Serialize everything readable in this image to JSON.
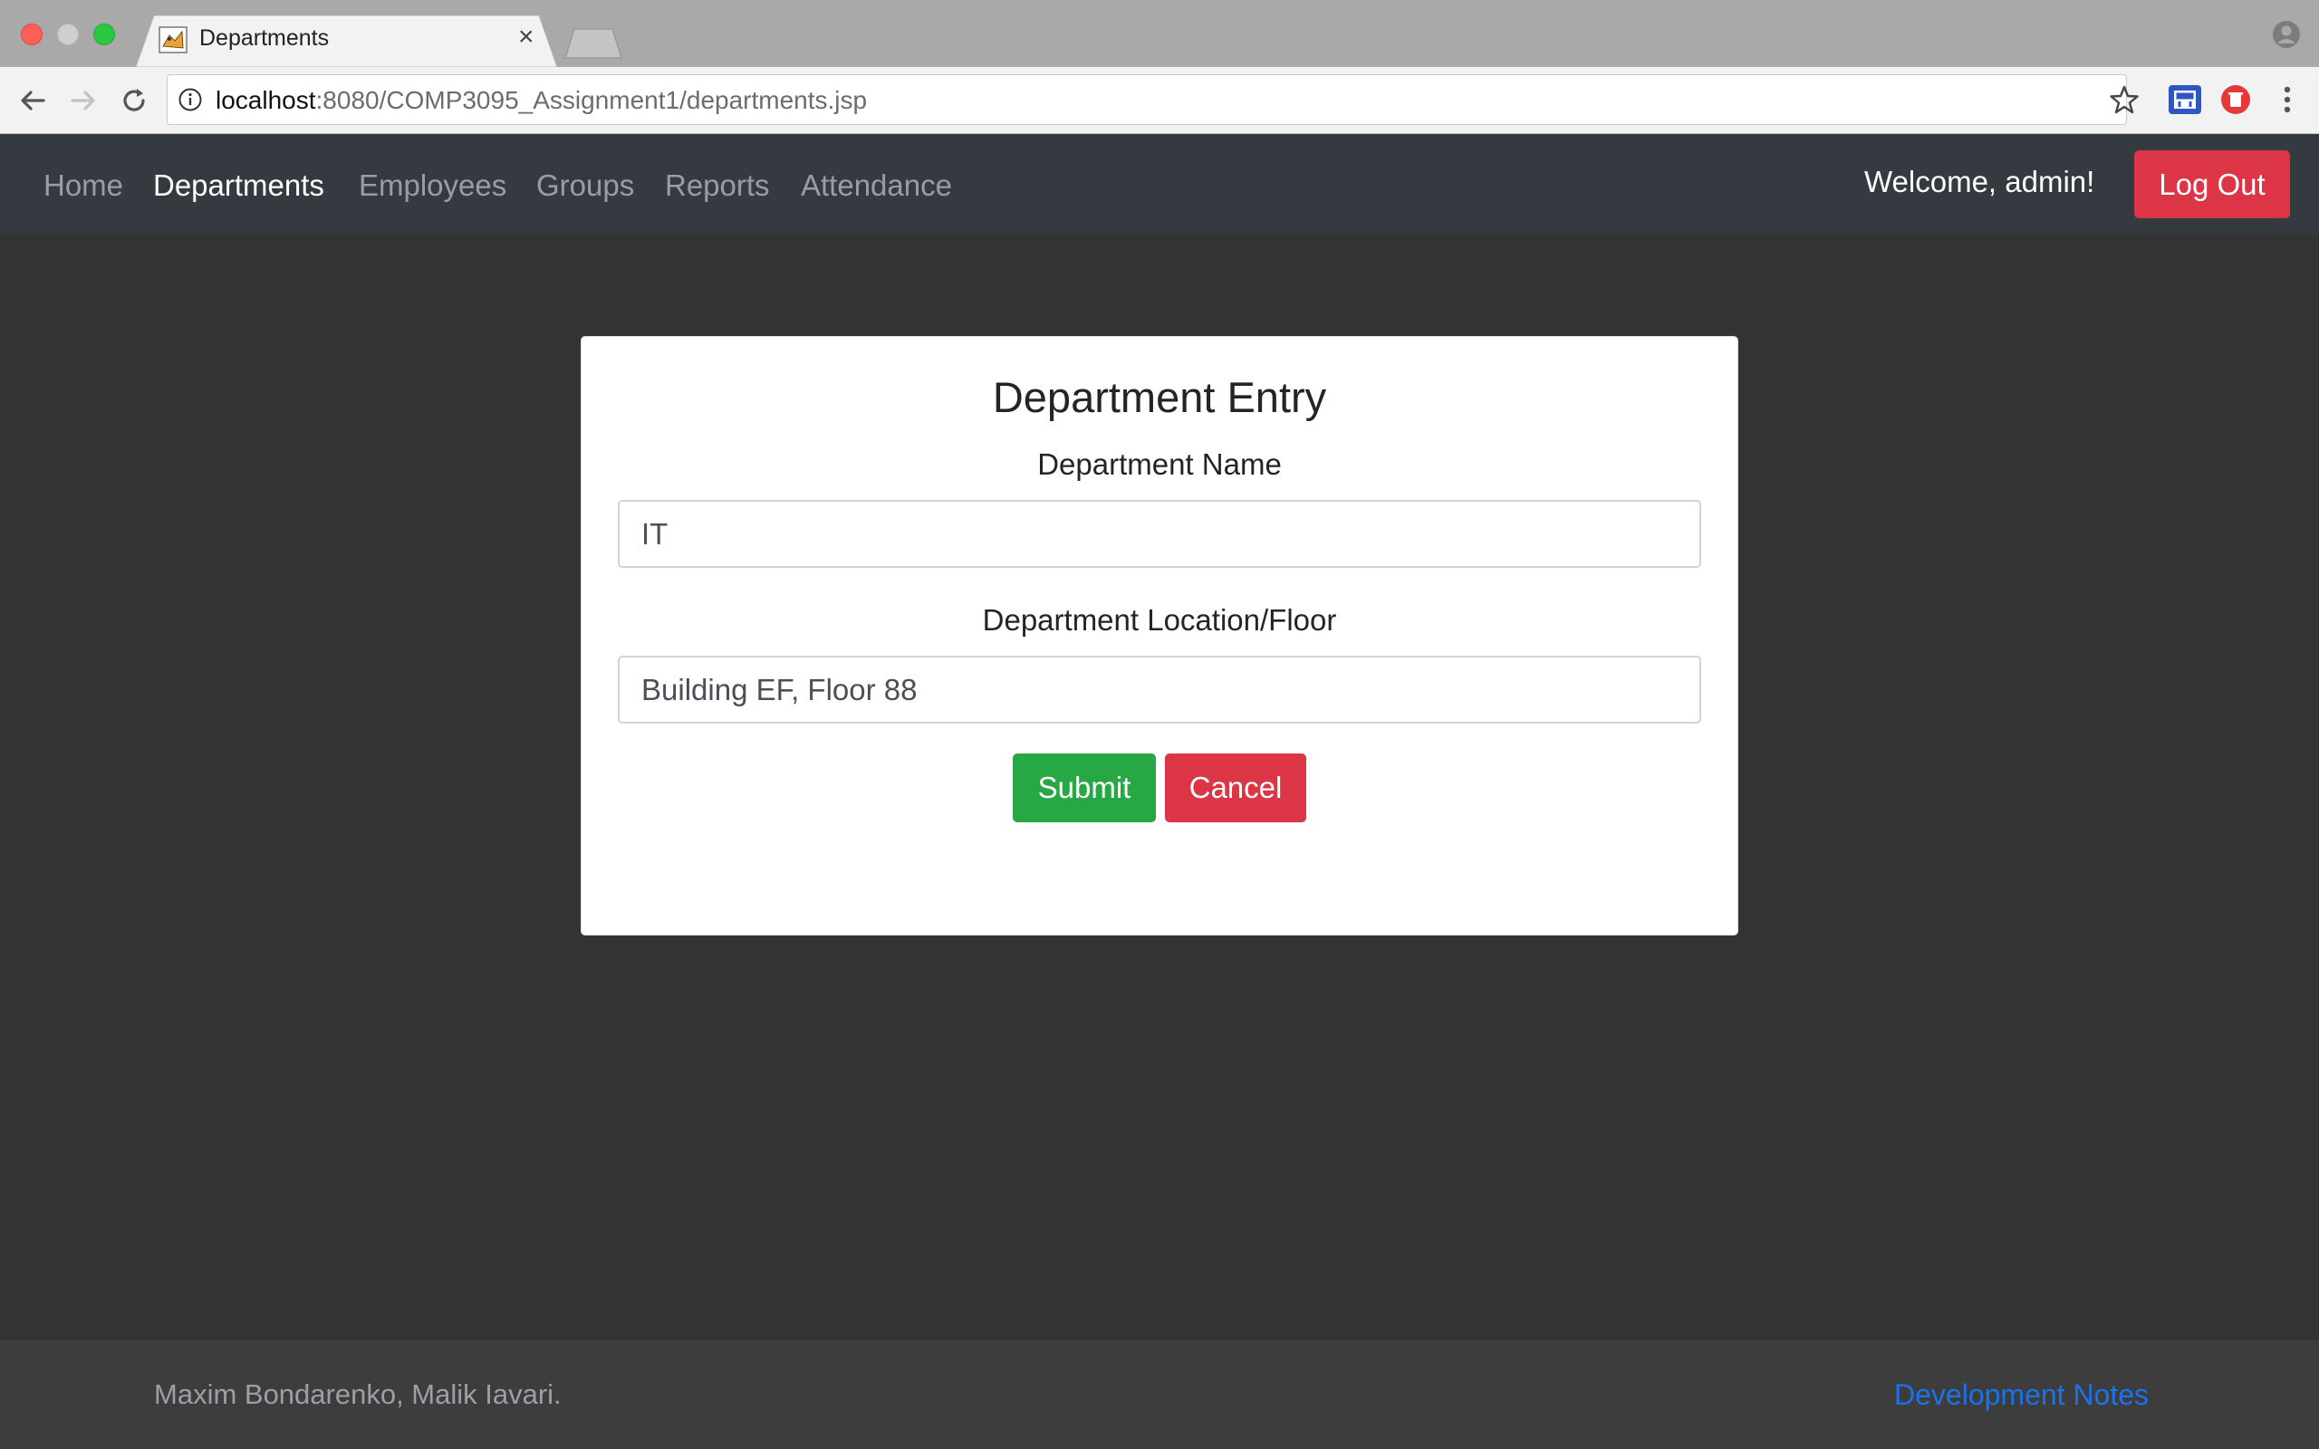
{
  "browser": {
    "tab_title": "Departments",
    "tab_close": "×",
    "url_host": "localhost",
    "url_rest": ":8080/COMP3095_Assignment1/departments.jsp"
  },
  "navbar": {
    "links": [
      "Home",
      "Departments",
      "Employees",
      "Groups",
      "Reports",
      "Attendance"
    ],
    "active": "Departments",
    "welcome": "Welcome, admin!",
    "logout_label": "Log Out"
  },
  "form": {
    "title": "Department Entry",
    "name_label": "Department Name",
    "name_value": "IT",
    "location_label": "Department Location/Floor",
    "location_value": "Building EF, Floor 88",
    "submit_label": "Submit",
    "cancel_label": "Cancel"
  },
  "footer": {
    "authors": "Maxim Bondarenko, Malik Iavari.",
    "link": "Development Notes"
  },
  "colors": {
    "navbar_bg": "#343a40",
    "page_bg": "#333333",
    "submit_green": "#28a745",
    "danger_red": "#dc3545",
    "link_blue": "#1a73e8"
  },
  "icons": [
    "back-arrow-icon",
    "forward-arrow-icon",
    "reload-icon",
    "info-icon",
    "star-icon",
    "extension-icon",
    "extension-red-icon",
    "menu-dots-icon",
    "profile-icon",
    "tomcat-favicon-icon"
  ]
}
